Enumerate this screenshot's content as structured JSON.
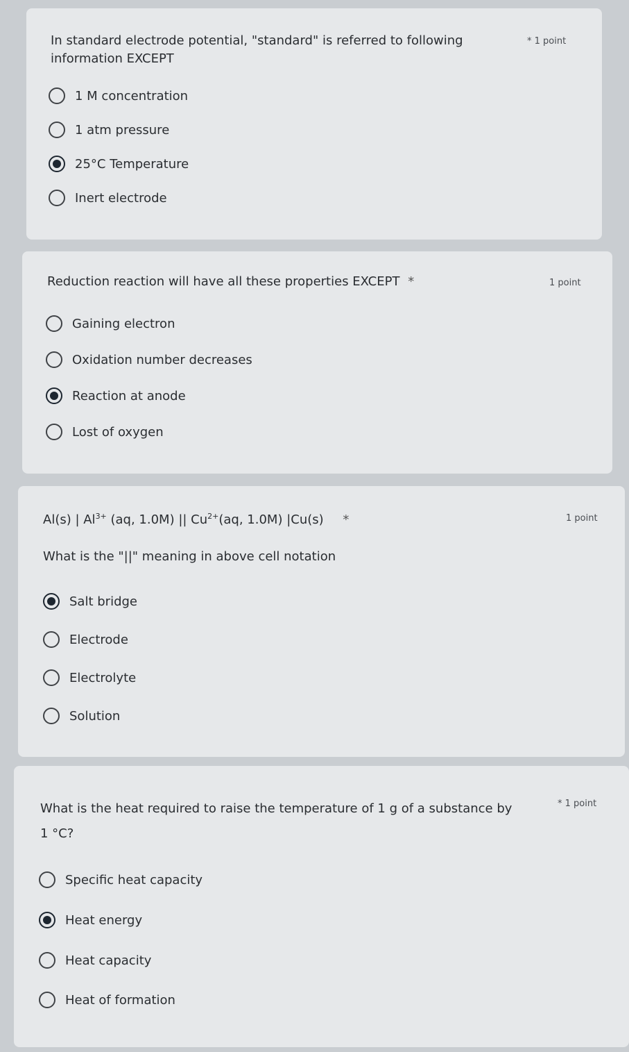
{
  "questions": [
    {
      "title_line1": "In standard electrode potential, \"standard\" is referred to following",
      "title_line2": "information EXCEPT",
      "required_mark": "*",
      "points": "1 point",
      "options": [
        "1 M concentration",
        "1 atm pressure",
        "25°C Temperature",
        "Inert electrode"
      ],
      "selected_index": 2
    },
    {
      "title_line1": "Reduction reaction will have all these properties EXCEPT",
      "required_mark": "*",
      "points": "1 point",
      "options": [
        "Gaining electron",
        "Oxidation number decreases",
        "Reaction at anode",
        "Lost of oxygen"
      ],
      "selected_index": 2
    },
    {
      "notation": {
        "part1": "Al(s) | Al",
        "sup1": "3+",
        "part2": " (aq, 1.0M) || Cu",
        "sup2": "2+",
        "part3": "(aq, 1.0M) |Cu(s)"
      },
      "required_mark": "*",
      "points": "1 point",
      "subtitle": "What is the \"||\" meaning in above cell notation",
      "options": [
        "Salt bridge",
        "Electrode",
        "Electrolyte",
        "Solution"
      ],
      "selected_index": 0
    },
    {
      "title_line1": "What is the heat required to raise the temperature of 1 g of a substance by",
      "title_line2": "1 °C?",
      "required_mark": "*",
      "points": "1 point",
      "options": [
        "Specific heat capacity",
        "Heat energy",
        "Heat capacity",
        "Heat of formation"
      ],
      "selected_index": 1
    }
  ]
}
